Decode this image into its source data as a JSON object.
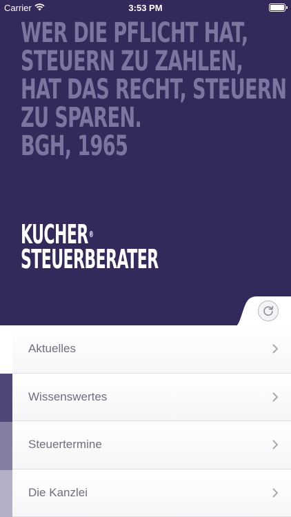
{
  "status_bar": {
    "carrier": "Carrier",
    "time": "3:53 PM"
  },
  "quote": {
    "lines": [
      "WER DIE PFLICHT HAT,",
      "STEUERN ZU ZAHLEN,",
      "HAT DAS RECHT, STEUERN",
      "ZU SPAREN.",
      "BGH, 1965"
    ]
  },
  "logo": {
    "line1": "KUCHER",
    "registered": "®",
    "line2": "STEUERBERATER"
  },
  "menu": {
    "items": [
      {
        "label": "Aktuelles"
      },
      {
        "label": "Wissenswertes"
      },
      {
        "label": "Steuertermine"
      },
      {
        "label": "Die Kanzlei"
      }
    ]
  },
  "colors": {
    "background": "#33295a",
    "quote_text": "#7d74a0",
    "menu_text": "#6d6f7e"
  }
}
